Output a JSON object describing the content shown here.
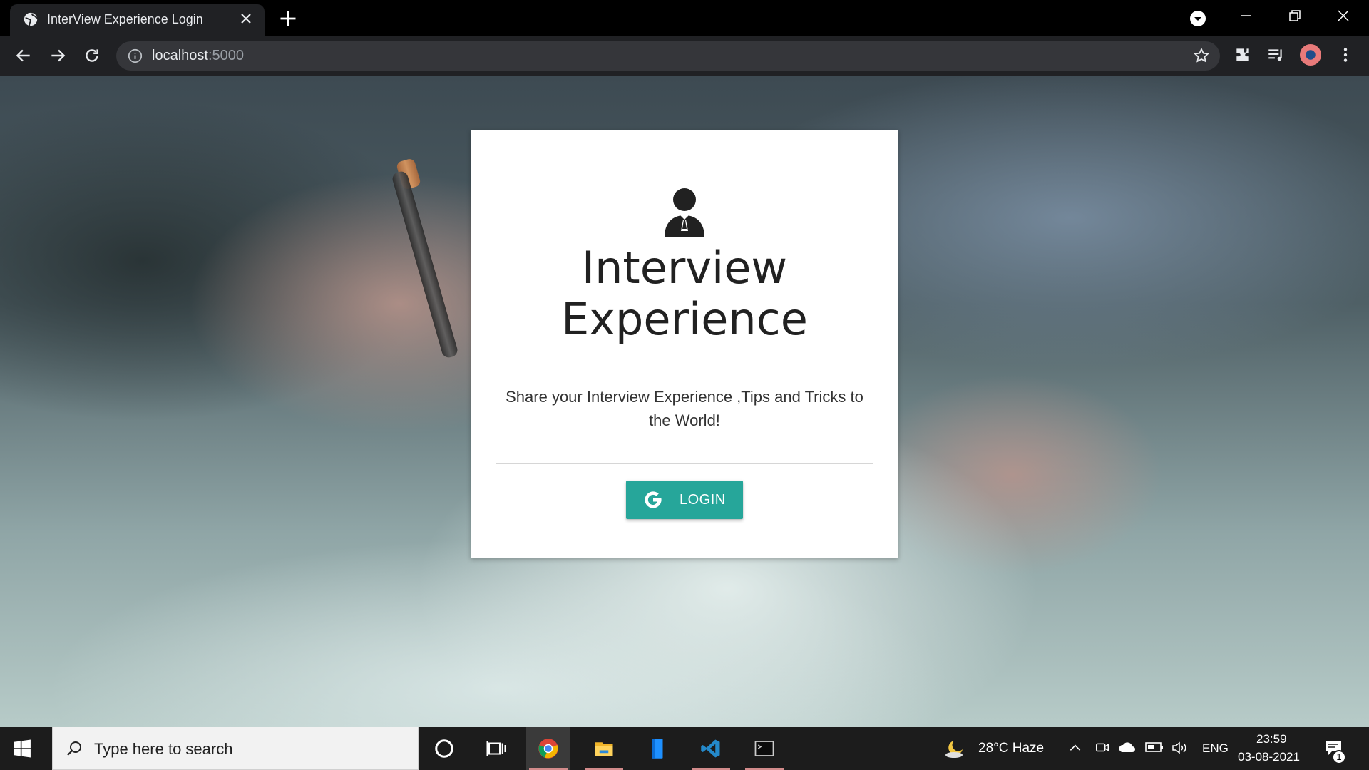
{
  "browser": {
    "tab_title": "InterView Experience Login",
    "url_host": "localhost",
    "url_port": ":5000"
  },
  "card": {
    "title_line1": "Interview",
    "title_line2": "Experience",
    "tagline": "Share your Interview Experience ,Tips and Tricks to the World!",
    "login_label": "LOGIN"
  },
  "taskbar": {
    "search_placeholder": "Type here to search",
    "weather": "28°C  Haze",
    "language": "ENG",
    "time": "23:59",
    "date": "03-08-2021",
    "notifications": "1"
  },
  "colors": {
    "accent": "#26a69a",
    "card_bg": "#ffffff",
    "chrome_bg": "#202124"
  }
}
